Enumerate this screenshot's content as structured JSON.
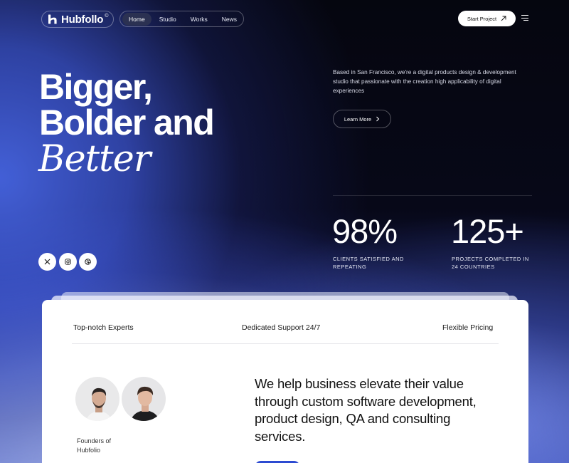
{
  "brand": {
    "name": "Hubfollo",
    "sup": "©"
  },
  "nav": {
    "items": [
      {
        "label": "Home",
        "active": true
      },
      {
        "label": "Studio",
        "active": false
      },
      {
        "label": "Works",
        "active": false
      },
      {
        "label": "News",
        "active": false
      }
    ],
    "cta_label": "Start Project"
  },
  "hero": {
    "line1": "Bigger,",
    "line2": "Bolder and",
    "italic": "Better",
    "intro": "Based in San Francisco, we're a digital products design & development studio that passionate with the creation high applicability of digital experiences",
    "learn_more": "Learn More"
  },
  "stats": [
    {
      "value": "98%",
      "label": "CLIENTS SATISFIED AND REPEATING"
    },
    {
      "value": "125+",
      "label": "PROJECTS COMPLETED IN 24 COUNTRIES"
    }
  ],
  "social": [
    {
      "icon": "x-icon"
    },
    {
      "icon": "instagram-icon"
    },
    {
      "icon": "dribbble-icon"
    }
  ],
  "card": {
    "features": [
      "Top-notch Experts",
      "Dedicated Support 24/7",
      "Flexible Pricing"
    ],
    "founders_label": "Founders of Hubfolio",
    "pitch": "We help business elevate their value through custom software development, product design, QA and consulting services."
  },
  "colors": {
    "accent_blue": "#2d4bd1",
    "background_dark": "#05060f",
    "card_background": "#ffffff"
  }
}
